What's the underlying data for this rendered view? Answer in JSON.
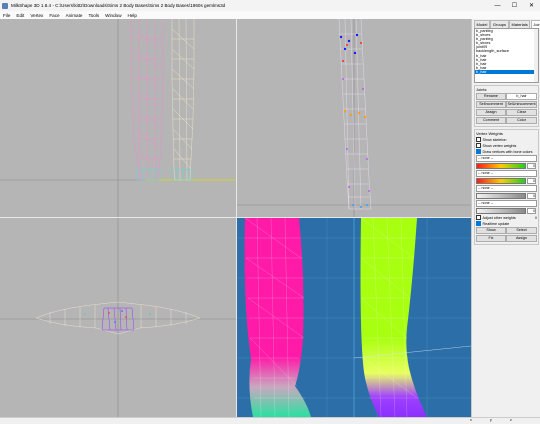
{
  "window": {
    "title": "MilkShape 3D 1.8.4 - C:\\Users\\kitt2\\Downloads\\Sims 2 Body Bases\\Sims 2 Body Bases\\1960s gemlms3d",
    "minimize_glyph": "—",
    "maximize_glyph": "☐",
    "close_glyph": "✕"
  },
  "menu": [
    "File",
    "Edit",
    "Vertex",
    "Face",
    "Animate",
    "Tools",
    "Window",
    "Help"
  ],
  "panel": {
    "tabs": [
      "Model",
      "Groups",
      "Materials",
      "Joints"
    ],
    "active_tab": "Joints",
    "joints": [
      "b_pantleg",
      "b_shoes",
      "b_pantleg",
      "b_shoes",
      "joint09",
      "backlength_surface",
      "b_hair",
      "b_hair",
      "b_hair",
      "b_hair",
      "b_hair"
    ],
    "selected_joint_index": 10,
    "joints_section": {
      "title": "Joints",
      "rename_label": "Rename",
      "name_value": "b_hair",
      "selincomment_label": "SelIncomment",
      "selunincomment_label": "SelUnincomment",
      "assign_label": "Assign",
      "clear_label": "Clear",
      "comment_label": "Comment",
      "color_label": "Color"
    },
    "vertex_weights": {
      "title": "Vertex Weights",
      "show_skeleton": "Show skeleton",
      "show_vertex_weights": "Show vertex weights",
      "draw_vertices_with_bone_colors": "Draw vertices with bone colors",
      "show_skeleton_checked": false,
      "show_vertex_weights_checked": false,
      "draw_vertices_checked": true,
      "combo1": "-- none --",
      "combo2": "-- none --",
      "combo3": "-- none --",
      "combo4": "-- none --",
      "val1": "0",
      "val2": "0",
      "val3": "0",
      "val4": "0",
      "adjust_other_weights": "Adjust other weights",
      "adjust_value": "0",
      "realtime_update": "Realtime update",
      "realtime_checked": true,
      "show_label": "Show",
      "select_label": "Select",
      "fix_label": "Fix",
      "assign_label": "Assign"
    }
  },
  "colors": {
    "viewport_bg": "#b5b5b5",
    "viewport_3d_bg": "#2c6ea7",
    "selected": "#0078d7",
    "mesh_pink": "#ff1aa8",
    "mesh_green": "#a8ff10"
  },
  "statusbar": {
    "left": "",
    "x": "x",
    "y": "y",
    "z": "z"
  }
}
